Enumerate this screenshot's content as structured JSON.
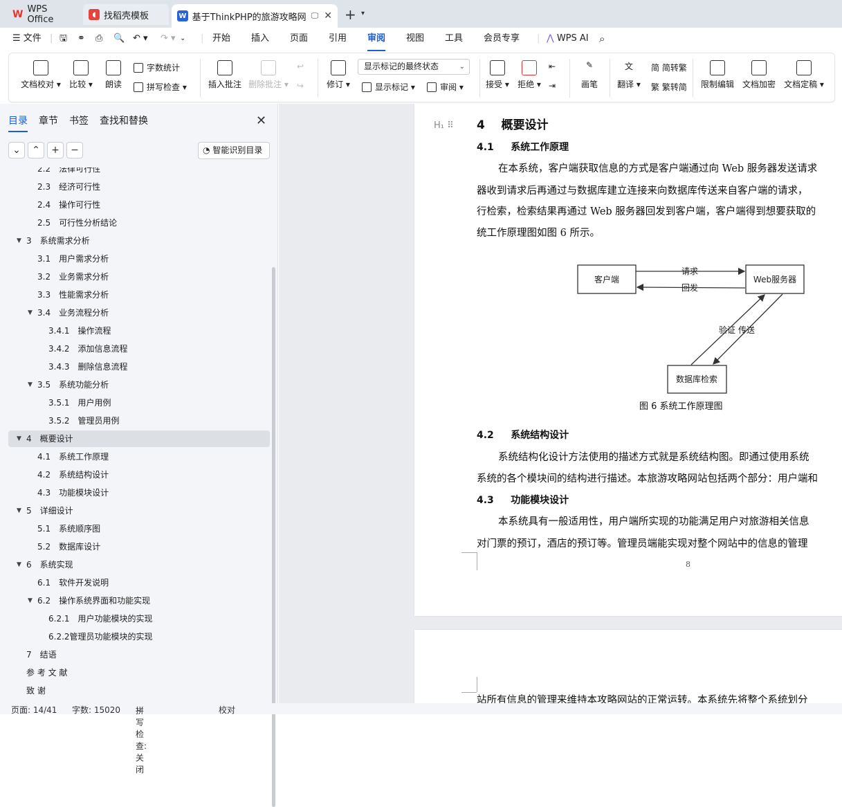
{
  "tabs": [
    {
      "label": "WPS Office"
    },
    {
      "label": "找稻壳模板"
    },
    {
      "label": "基于ThinkPHP的旅游攻略网站"
    }
  ],
  "menu": {
    "file": "文件",
    "items": [
      "开始",
      "插入",
      "页面",
      "引用",
      "审阅",
      "视图",
      "工具",
      "会员专享"
    ],
    "active": "审阅",
    "wps_ai": "WPS AI"
  },
  "ribbon": {
    "doc_check": "文档校对",
    "compare": "比较",
    "read_aloud": "朗读",
    "word_count": "字数统计",
    "spell_check": "拼写检查",
    "insert_comment": "插入批注",
    "delete_comment": "删除批注",
    "track": "修订",
    "display_state": "显示标记的最终状态",
    "show_markup": "显示标记",
    "review": "审阅",
    "accept": "接受",
    "reject": "拒绝",
    "pen": "画笔",
    "translate": "翻译",
    "to_traditional": "简转繁",
    "to_simplified": "繁转简",
    "restrict_edit": "限制编辑",
    "encrypt": "文档加密",
    "finalize": "文档定稿"
  },
  "nav": {
    "tabs": [
      "目录",
      "章节",
      "书签",
      "查找和替换"
    ],
    "active_tab": "目录",
    "smart_toc": "智能识别目录",
    "items": [
      {
        "num": "2.2",
        "text": "法律可行性",
        "level": 2
      },
      {
        "num": "2.3",
        "text": "经济可行性",
        "level": 2
      },
      {
        "num": "2.4",
        "text": "操作可行性",
        "level": 2
      },
      {
        "num": "2.5",
        "text": "可行性分析结论",
        "level": 2
      },
      {
        "num": "3",
        "text": "系统需求分析",
        "level": 1,
        "arrow": true
      },
      {
        "num": "3.1",
        "text": "用户需求分析",
        "level": 2
      },
      {
        "num": "3.2",
        "text": "业务需求分析",
        "level": 2
      },
      {
        "num": "3.3",
        "text": "性能需求分析",
        "level": 2
      },
      {
        "num": "3.4",
        "text": "业务流程分析",
        "level": 2,
        "arrow": true
      },
      {
        "num": "3.4.1",
        "text": "操作流程",
        "level": 3
      },
      {
        "num": "3.4.2",
        "text": "添加信息流程",
        "level": 3
      },
      {
        "num": "3.4.3",
        "text": "删除信息流程",
        "level": 3
      },
      {
        "num": "3.5",
        "text": "系统功能分析",
        "level": 2,
        "arrow": true
      },
      {
        "num": "3.5.1",
        "text": "用户用例",
        "level": 3
      },
      {
        "num": "3.5.2",
        "text": "管理员用例",
        "level": 3
      },
      {
        "num": "4",
        "text": "概要设计",
        "level": 1,
        "arrow": true,
        "selected": true
      },
      {
        "num": "4.1",
        "text": "系统工作原理",
        "level": 2
      },
      {
        "num": "4.2",
        "text": "系统结构设计",
        "level": 2
      },
      {
        "num": "4.3",
        "text": "功能模块设计",
        "level": 2
      },
      {
        "num": "5",
        "text": "详细设计",
        "level": 1,
        "arrow": true
      },
      {
        "num": "5.1",
        "text": "系统顺序图",
        "level": 2
      },
      {
        "num": "5.2",
        "text": "数据库设计",
        "level": 2
      },
      {
        "num": "6",
        "text": "系统实现",
        "level": 1,
        "arrow": true
      },
      {
        "num": "6.1",
        "text": "软件开发说明",
        "level": 2
      },
      {
        "num": "6.2",
        "text": "操作系统界面和功能实现",
        "level": 2,
        "arrow": true
      },
      {
        "num": "6.2.1",
        "text": "用户功能模块的实现",
        "level": 3
      },
      {
        "num": "",
        "text": "6.2.2管理员功能模块的实现",
        "level": 3
      },
      {
        "num": "7",
        "text": "结语",
        "level": 1
      },
      {
        "num": "",
        "text": "参 考 文 献",
        "level": 1
      },
      {
        "num": "",
        "text": "致      谢",
        "level": 1
      }
    ]
  },
  "doc": {
    "h_heading_icon": "H₁",
    "ch4_num": "4",
    "ch4_title": "概要设计",
    "s41_num": "4.1",
    "s41_title": "系统工作原理",
    "p1_l1": "在本系统，客户端获取信息的方式是客户端通过向 Web 服务器发送请求",
    "p1_l2": "器收到请求后再通过与数据库建立连接来向数据库传送来自客户端的请求，",
    "p1_l3": "行检索，检索结果再通过 Web 服务器回发到客户端，客户端得到想要获取的",
    "p1_l4": "统工作原理图如图 6 所示。",
    "diagram": {
      "client": "客户端",
      "server": "Web服务器",
      "db": "数据库检索",
      "request": "请求",
      "reply": "回发",
      "verify": "验证",
      "transfer": "传送"
    },
    "caption": "图 6    系统工作原理图",
    "s42_num": "4.2",
    "s42_title": "系统结构设计",
    "p2_l1": "系统结构化设计方法使用的描述方式就是系统结构图。即通过使用系统",
    "p2_l2": "系统的各个模块间的结构进行描述。本旅游攻略网站包括两个部分：用户端和",
    "s43_num": "4.3",
    "s43_title": "功能模块设计",
    "p3_l1": "本系统具有一般适用性，用户端所实现的功能满足用户对旅游相关信息",
    "p3_l2": "对门票的预订，酒店的预订等。管理员端能实现对整个网站中的信息的管理",
    "page_num": "8",
    "page2_line": "站所有信息的管理来维持本攻略网站的正常运转。本系统先将整个系统划分"
  },
  "status": {
    "page": "页面: 14/41",
    "words": "字数: 15020",
    "spell": "拼写检查: 关闭",
    "proof": "校对"
  },
  "colors": {
    "accent": "#1a5fd6",
    "wps_red": "#e8342e",
    "docer_red": "#e5443c",
    "writer_blue": "#2a63d8"
  }
}
